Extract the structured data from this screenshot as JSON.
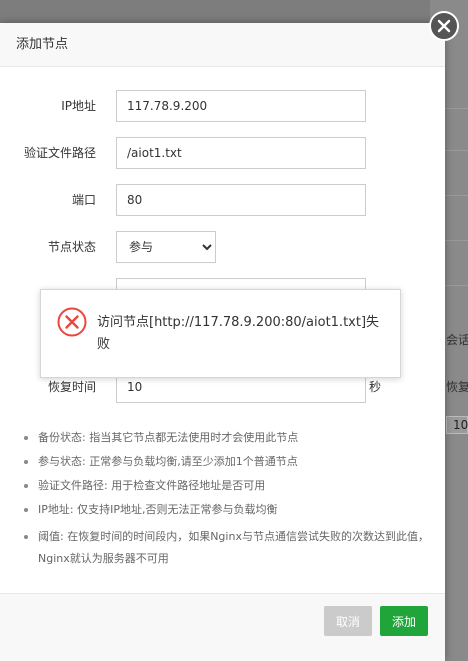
{
  "background": {
    "text_1": "会话(发",
    "text_2": "恢复",
    "box_value": "10"
  },
  "dialog": {
    "title": "添加节点",
    "close_icon": "close-icon"
  },
  "form": {
    "ip": {
      "label": "IP地址",
      "value": "117.78.9.200"
    },
    "path": {
      "label": "验证文件路径",
      "value": "/aiot1.txt"
    },
    "port": {
      "label": "端口",
      "value": "80"
    },
    "status": {
      "label": "节点状态",
      "selected": "参与"
    },
    "hidden_value": "",
    "recovery": {
      "label": "恢复时间",
      "value": "10",
      "unit": "秒"
    }
  },
  "tips": [
    "备份状态: 指当其它节点都无法使用时才会使用此节点",
    "参与状态: 正常参与负载均衡,请至少添加1个普通节点",
    "验证文件路径: 用于检查文件路径地址是否可用",
    "IP地址: 仅支持IP地址,否则无法正常参与负载均衡",
    "阈值: 在恢复时间的时间段内，如果Nginx与节点通信尝试失败的次数达到此值，Nginx就认为服务器不可用"
  ],
  "footer": {
    "cancel_label": "取消",
    "add_label": "添加"
  },
  "toast": {
    "icon": "error-icon",
    "message": "访问节点[http://117.78.9.200:80/aiot1.txt]失败",
    "color": "#e8483d"
  }
}
